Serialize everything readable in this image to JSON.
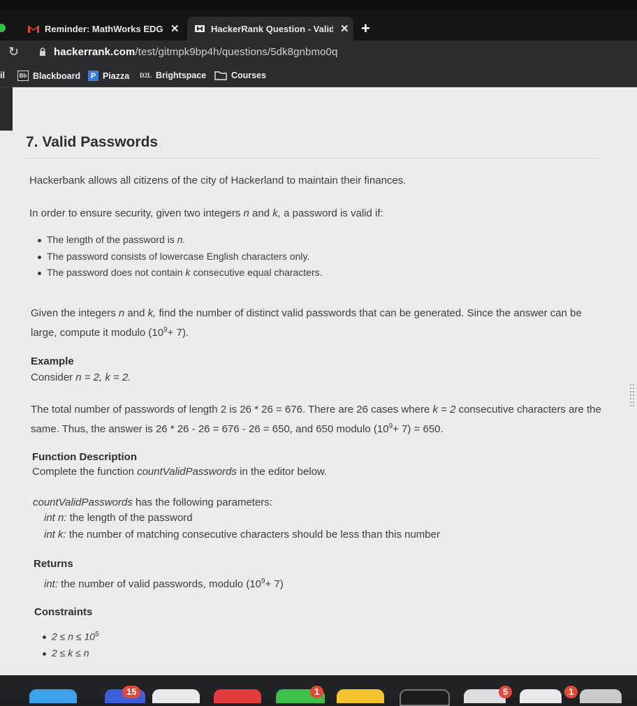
{
  "browser": {
    "tabs": [
      {
        "label": "Reminder: MathWorks EDG Pr",
        "favicon": "gmail-icon",
        "close": "✕"
      },
      {
        "label": "HackerRank Question - Valid P",
        "favicon": "hackerrank-icon",
        "close": "✕"
      }
    ],
    "new_tab": "+",
    "url_host": "hackerrank.com",
    "url_path": "/test/gitmpk9bp4h/questions/5dk8gnbmo0q",
    "bookmarks": [
      {
        "label": "Blackboard",
        "icon": "Bb"
      },
      {
        "label": "Piazza",
        "icon": "P"
      },
      {
        "label": "Brightspace",
        "icon": "D2L"
      },
      {
        "label": "Courses",
        "icon": "folder-icon"
      }
    ]
  },
  "question": {
    "title": "7. Valid Passwords",
    "intro": "Hackerbank allows all citizens of the city of Hackerland to maintain their finances.",
    "condition_lead": {
      "a": "In order to ensure security, given two integers ",
      "n": "n",
      "b": " and ",
      "k": "k,",
      "c": " a password is valid if:"
    },
    "rules": [
      {
        "a": "The length of the password is ",
        "v": "n.",
        "b": ""
      },
      {
        "a": "The password consists of lowercase English characters only.",
        "v": "",
        "b": ""
      },
      {
        "a": "The password does not contain ",
        "v": "k",
        "b": " consecutive equal characters."
      }
    ],
    "task": {
      "line1a": "Given the integers ",
      "n": "n",
      "line1b": " and ",
      "k": "k,",
      "line1c": " find the number of distinct valid passwords that can be generated. Since the answer can be",
      "line2a": "large, compute it modulo (10",
      "exp": "9",
      "line2b": "+ 7)."
    },
    "example": {
      "heading": "Example",
      "consider_a": "Consider ",
      "consider_v": "n = 2, k = 2.",
      "exp1a": "The total number of passwords of length 2 is 26 * 26 = 676. There are 26 cases where ",
      "exp1v": "k = 2",
      "exp1b": " consecutive characters are the",
      "exp2a": "same. Thus, the answer is 26 * 26 - 26 = 676 - 26 = 650, and 650 modulo (10",
      "exp2exp": "9",
      "exp2b": "+ 7) = 650."
    },
    "function_description": {
      "heading": "Function Description",
      "line_a": "Complete the function ",
      "fname": "countValidPasswords",
      "line_b": " in the editor below.",
      "params_fname": "countValidPasswords",
      "params_b": " has the following parameters:",
      "p1v": "int n:",
      "p1b": " the length of the password",
      "p2v": "int k:",
      "p2b": " the number of matching consecutive characters should be less than this number"
    },
    "returns": {
      "heading": "Returns",
      "v": "int:",
      "b": " the number of valid passwords, modulo (10",
      "exp": "9",
      "c": "+ 7)"
    },
    "constraints": {
      "heading": "Constraints",
      "c1a": "2 ≤ n ≤ 10",
      "c1exp": "5",
      "c2": "2 ≤ k ≤ n"
    }
  },
  "dock": {
    "badges": [
      "15",
      "1",
      "5",
      "1"
    ]
  }
}
